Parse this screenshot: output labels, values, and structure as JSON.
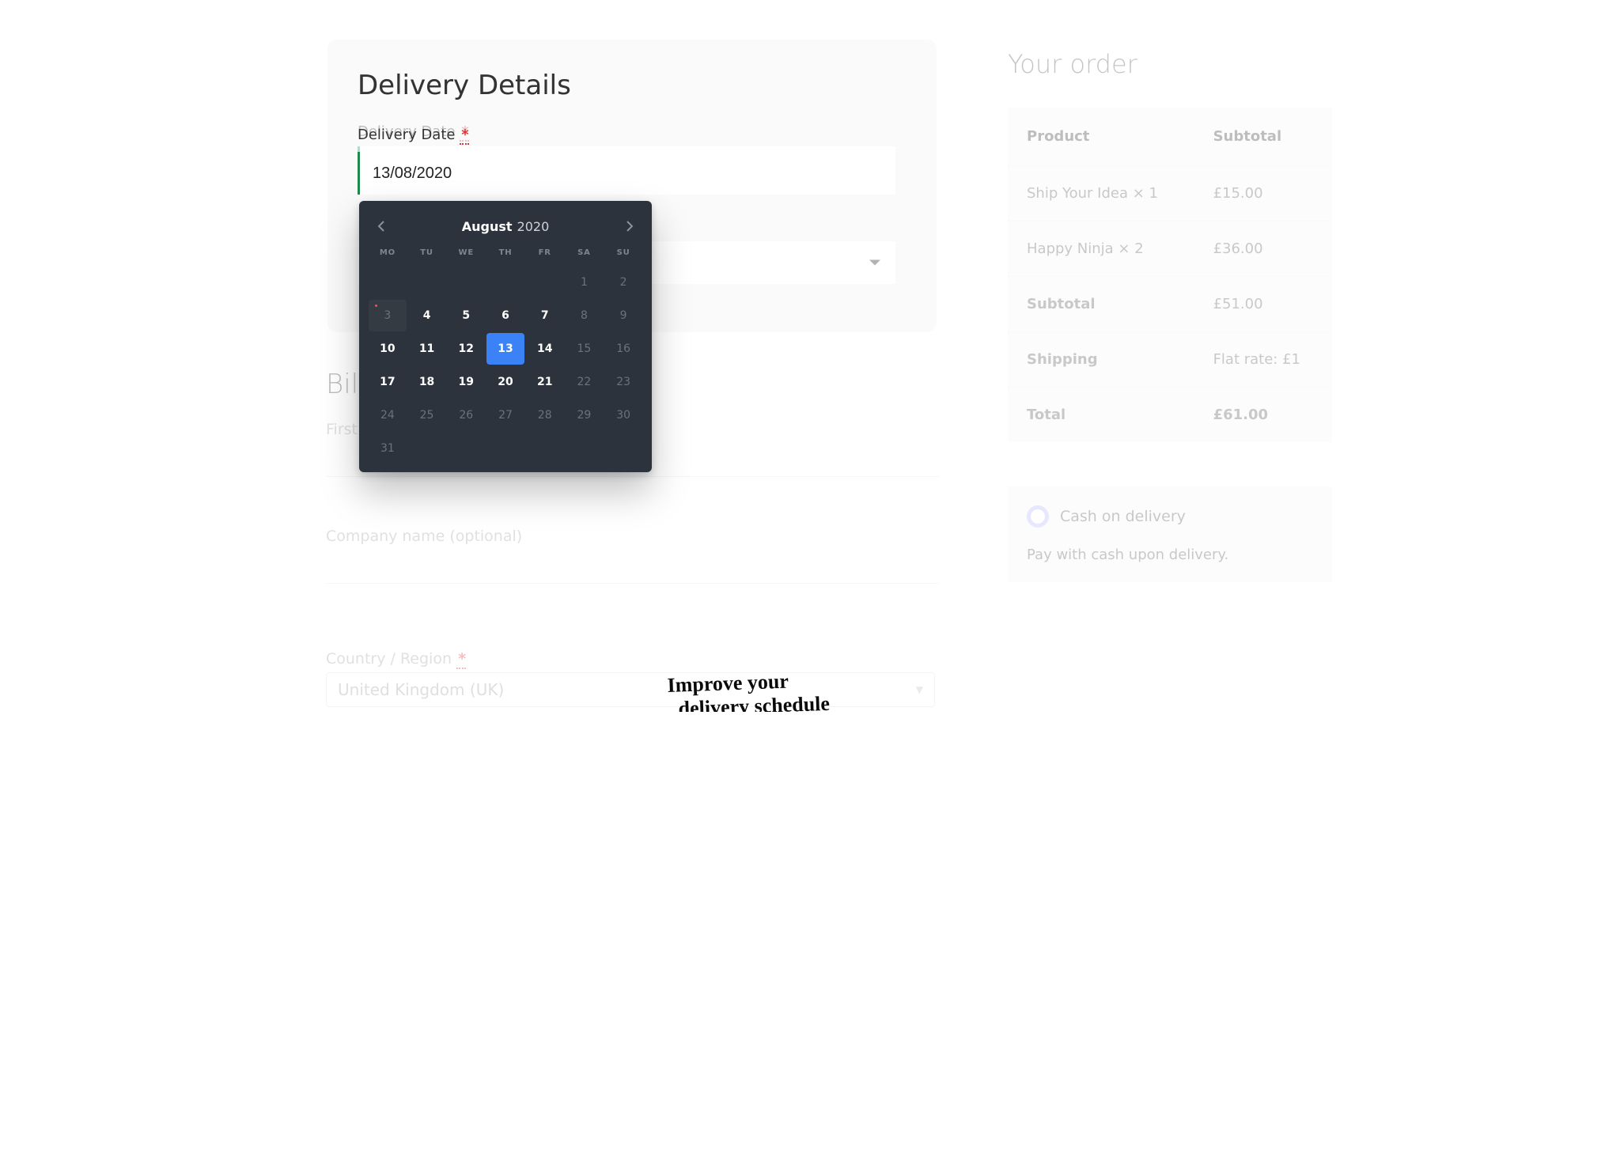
{
  "delivery": {
    "heading": "Delivery Details",
    "date_label": "Delivery Date",
    "required_mark": "*",
    "date_value": "13/08/2020"
  },
  "billing": {
    "heading": "Bil",
    "first_name_label": "First",
    "company_label": "Company name (optional)",
    "country_label": "Country / Region",
    "country_value": "United Kingdom (UK)"
  },
  "annotation": {
    "line1": "Improve your",
    "line2": "delivery schedule"
  },
  "datepicker": {
    "month": "August",
    "year": "2020",
    "dows": [
      "MO",
      "TU",
      "WE",
      "TH",
      "FR",
      "SA",
      "SU"
    ],
    "weeks": [
      [
        {
          "n": "",
          "s": "blank"
        },
        {
          "n": "",
          "s": "blank"
        },
        {
          "n": "",
          "s": "blank"
        },
        {
          "n": "",
          "s": "blank"
        },
        {
          "n": "",
          "s": "blank"
        },
        {
          "n": "1",
          "s": "in"
        },
        {
          "n": "2",
          "s": "in"
        }
      ],
      [
        {
          "n": "3",
          "s": "in",
          "dot": true,
          "today": true
        },
        {
          "n": "4",
          "s": "act"
        },
        {
          "n": "5",
          "s": "act"
        },
        {
          "n": "6",
          "s": "act"
        },
        {
          "n": "7",
          "s": "act"
        },
        {
          "n": "8",
          "s": "in"
        },
        {
          "n": "9",
          "s": "in"
        }
      ],
      [
        {
          "n": "10",
          "s": "act"
        },
        {
          "n": "11",
          "s": "act"
        },
        {
          "n": "12",
          "s": "act"
        },
        {
          "n": "13",
          "s": "sel"
        },
        {
          "n": "14",
          "s": "act"
        },
        {
          "n": "15",
          "s": "in"
        },
        {
          "n": "16",
          "s": "in"
        }
      ],
      [
        {
          "n": "17",
          "s": "act"
        },
        {
          "n": "18",
          "s": "act"
        },
        {
          "n": "19",
          "s": "act"
        },
        {
          "n": "20",
          "s": "act"
        },
        {
          "n": "21",
          "s": "act"
        },
        {
          "n": "22",
          "s": "in"
        },
        {
          "n": "23",
          "s": "in"
        }
      ],
      [
        {
          "n": "24",
          "s": "in"
        },
        {
          "n": "25",
          "s": "in"
        },
        {
          "n": "26",
          "s": "in"
        },
        {
          "n": "27",
          "s": "in"
        },
        {
          "n": "28",
          "s": "in"
        },
        {
          "n": "29",
          "s": "in"
        },
        {
          "n": "30",
          "s": "in"
        }
      ],
      [
        {
          "n": "31",
          "s": "in"
        },
        {
          "n": "",
          "s": "blank"
        },
        {
          "n": "",
          "s": "blank"
        },
        {
          "n": "",
          "s": "blank"
        },
        {
          "n": "",
          "s": "blank"
        },
        {
          "n": "",
          "s": "blank"
        },
        {
          "n": "",
          "s": "blank"
        }
      ]
    ]
  },
  "order": {
    "heading": "Your order",
    "col_product": "Product",
    "col_subtotal": "Subtotal",
    "rows": [
      {
        "name": "Ship Your Idea  × 1",
        "price": "£15.00"
      },
      {
        "name": "Happy Ninja  × 2",
        "price": "£36.00"
      }
    ],
    "subtotal_label": "Subtotal",
    "subtotal_value": "£51.00",
    "shipping_label": "Shipping",
    "shipping_value": "Flat rate: £1",
    "total_label": "Total",
    "total_value": "£61.00",
    "payment_option": "Cash on delivery",
    "payment_note": "Pay with cash upon delivery."
  },
  "icons": {
    "caret_down": "▼"
  }
}
